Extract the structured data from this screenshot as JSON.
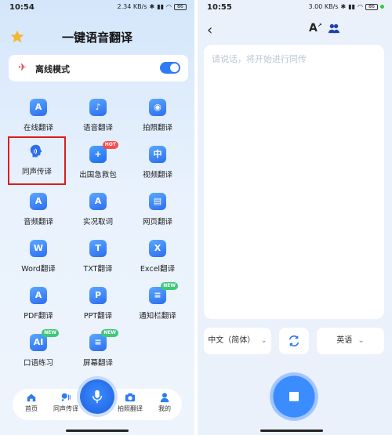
{
  "left": {
    "status": {
      "time": "10:54",
      "net": "2.34 KB/s",
      "battery": "86"
    },
    "title": "一键语音翻译",
    "offline": {
      "label": "离线模式",
      "enabled": true
    },
    "features": [
      {
        "label": "在线翻译",
        "icon": "A"
      },
      {
        "label": "语音翻译",
        "icon": "♪"
      },
      {
        "label": "拍照翻译",
        "icon": "◉"
      },
      {
        "label": "同声传译",
        "icon": ""
      },
      {
        "label": "出国急救包",
        "icon": "+",
        "badge": "HOT"
      },
      {
        "label": "视频翻译",
        "icon": "中"
      },
      {
        "label": "音频翻译",
        "icon": "A"
      },
      {
        "label": "实况取词",
        "icon": "A"
      },
      {
        "label": "网页翻译",
        "icon": "▤"
      },
      {
        "label": "Word翻译",
        "icon": "W"
      },
      {
        "label": "TXT翻译",
        "icon": "T"
      },
      {
        "label": "Excel翻译",
        "icon": "X"
      },
      {
        "label": "PDF翻译",
        "icon": "A"
      },
      {
        "label": "PPT翻译",
        "icon": "P"
      },
      {
        "label": "通知栏翻译",
        "icon": "≡",
        "badge": "NEW"
      },
      {
        "label": "口语练习",
        "icon": "AI",
        "badge": "NEW"
      },
      {
        "label": "屏幕翻译",
        "icon": "≡",
        "badge": "NEW"
      }
    ],
    "nav": [
      {
        "label": "首页",
        "icon": "home-icon"
      },
      {
        "label": "同声传译",
        "icon": "speaker-icon"
      },
      {
        "label": "拍照翻译",
        "icon": "camera-icon"
      },
      {
        "label": "我的",
        "icon": "person-icon"
      }
    ]
  },
  "right": {
    "status": {
      "time": "10:55",
      "net": "3.00 KB/s",
      "battery": "86"
    },
    "placeholder": "请说话，将开始进行同传",
    "source_lang": "中文（简体）",
    "target_lang": "英语"
  },
  "colors": {
    "accent": "#2d7cf6",
    "selection": "#e01b1b",
    "hot": "#ff4a4a",
    "new": "#3dc97a"
  }
}
